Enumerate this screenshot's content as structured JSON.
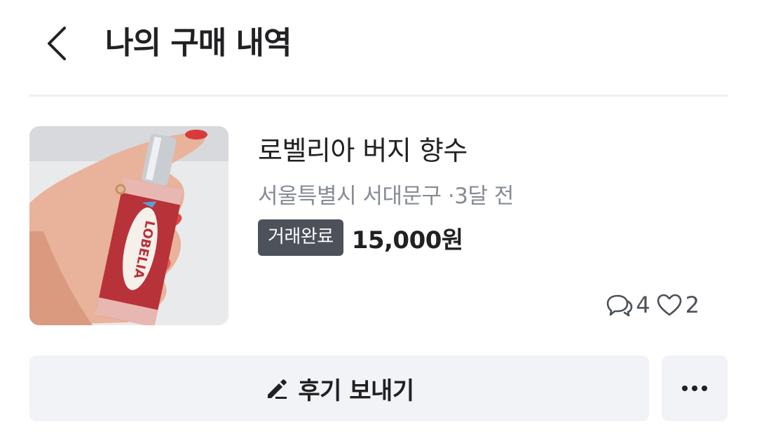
{
  "header": {
    "back_icon": "chevron-left-icon",
    "title": "나의 구매 내역"
  },
  "item": {
    "title": "로벨리아 버지 향수",
    "location": "서울특별시 서대문구",
    "separator": "·",
    "time_ago": "3달 전",
    "status": "거래완료",
    "price": "15,000원",
    "product_label": "LOBELIA",
    "chat_count": "4",
    "like_count": "2"
  },
  "actions": {
    "review_label": "후기 보내기",
    "review_icon": "pencil-icon",
    "more_icon": "more-horizontal-icon"
  },
  "colors": {
    "text": "#212124",
    "muted": "#868b94",
    "badge_bg": "#4d5159",
    "button_bg": "#f2f3f6",
    "divider": "#eeeff1"
  }
}
